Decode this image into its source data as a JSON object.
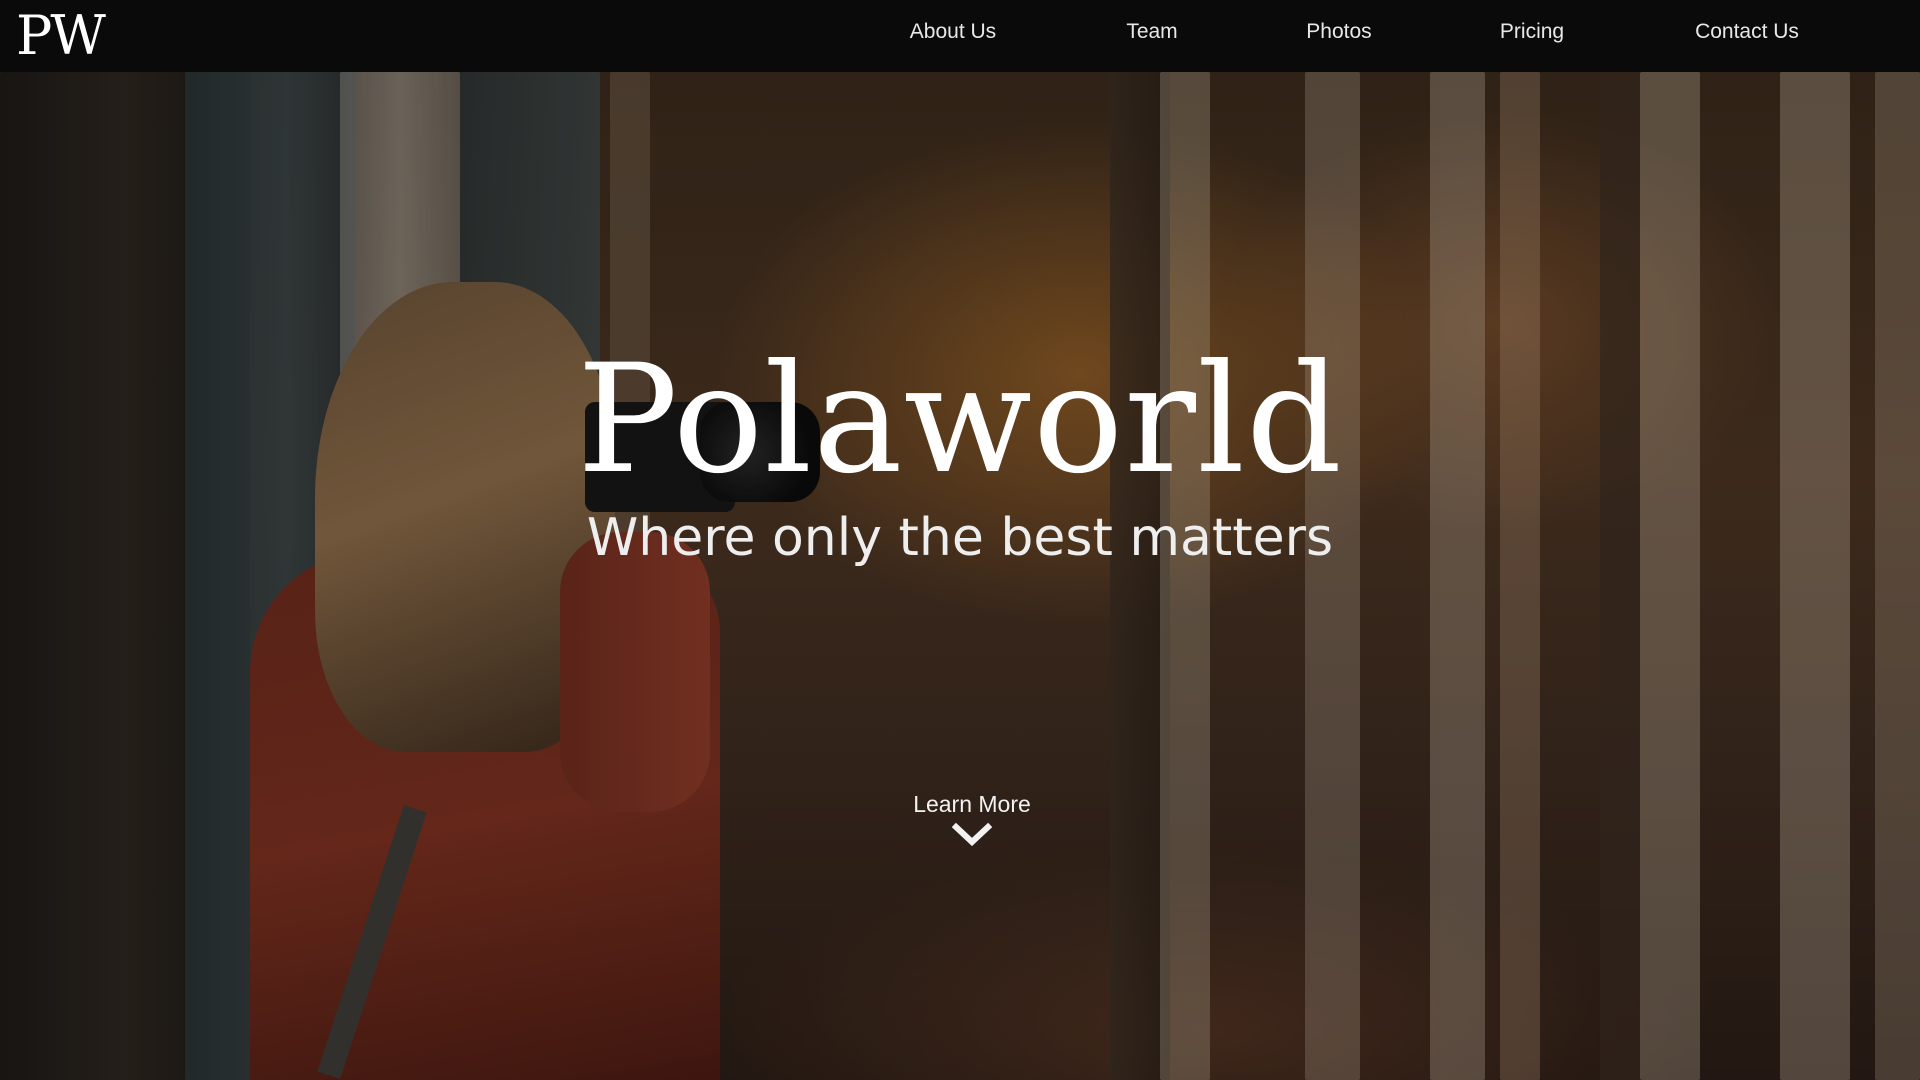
{
  "nav": {
    "logo": "PW",
    "links": [
      {
        "label": "About Us"
      },
      {
        "label": "Team"
      },
      {
        "label": "Photos"
      },
      {
        "label": "Pricing"
      },
      {
        "label": "Contact Us"
      }
    ]
  },
  "hero": {
    "title": "Polaworld",
    "subtitle": "Where only the best matters",
    "cta_label": "Learn More",
    "cta_icon": "chevron-down-icon"
  },
  "colors": {
    "nav_bg": "#0a0a0a",
    "text": "#ffffff"
  }
}
